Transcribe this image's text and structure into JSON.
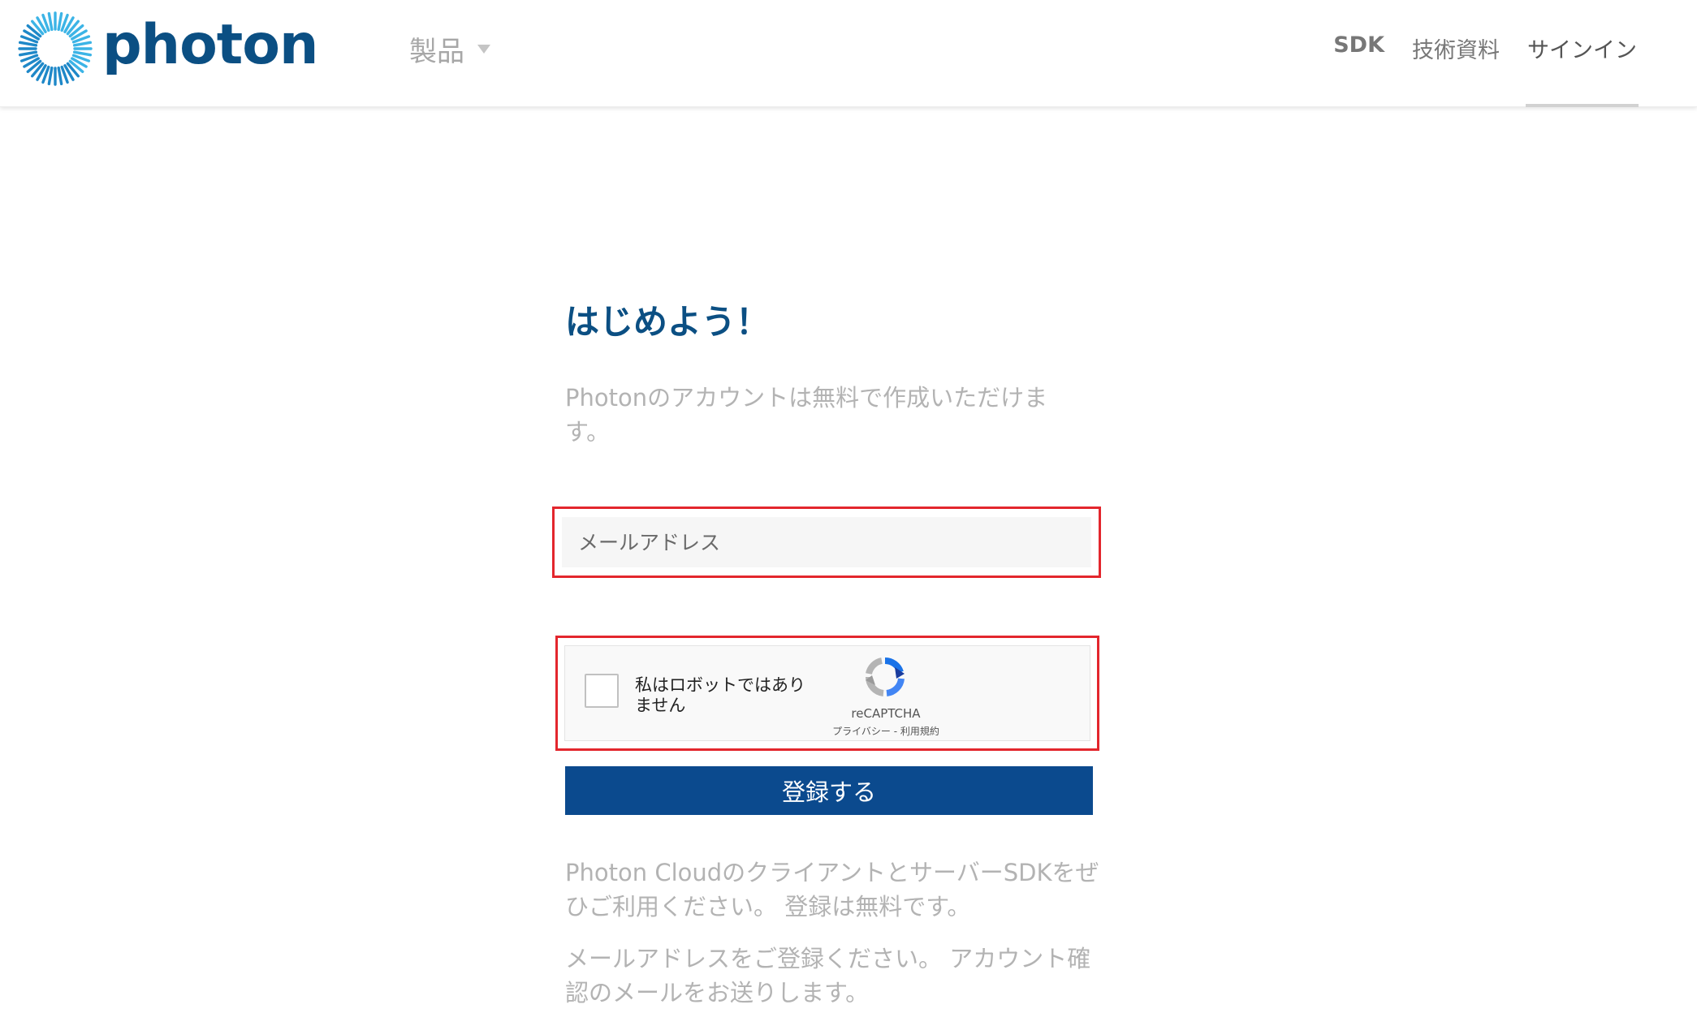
{
  "header": {
    "brand": "photon",
    "nav_products": "製品",
    "nav_links": {
      "sdk": "SDK",
      "docs": "技術資料",
      "signin": "サインイン"
    },
    "active_link": "signin"
  },
  "main": {
    "title": "はじめよう！",
    "intro": "Photonのアカウントは無料で作成いただけます。",
    "email_placeholder": "メールアドレス",
    "email_value": "",
    "captcha": {
      "label": "私はロボットではありません",
      "checked": false,
      "brand": "reCAPTCHA",
      "privacy": "プライバシー",
      "separator": " - ",
      "terms": "利用規約"
    },
    "register_button": "登録する",
    "description_1": "Photon CloudのクライアントとサーバーSDKをぜひご利用ください。 登録は無料です。",
    "description_2": "メールアドレスをご登録ください。 アカウント確認のメールをお送りします。"
  },
  "colors": {
    "brand_blue": "#0b4f83",
    "button_blue": "#0b4a8e",
    "highlight_red": "#e3262d"
  }
}
